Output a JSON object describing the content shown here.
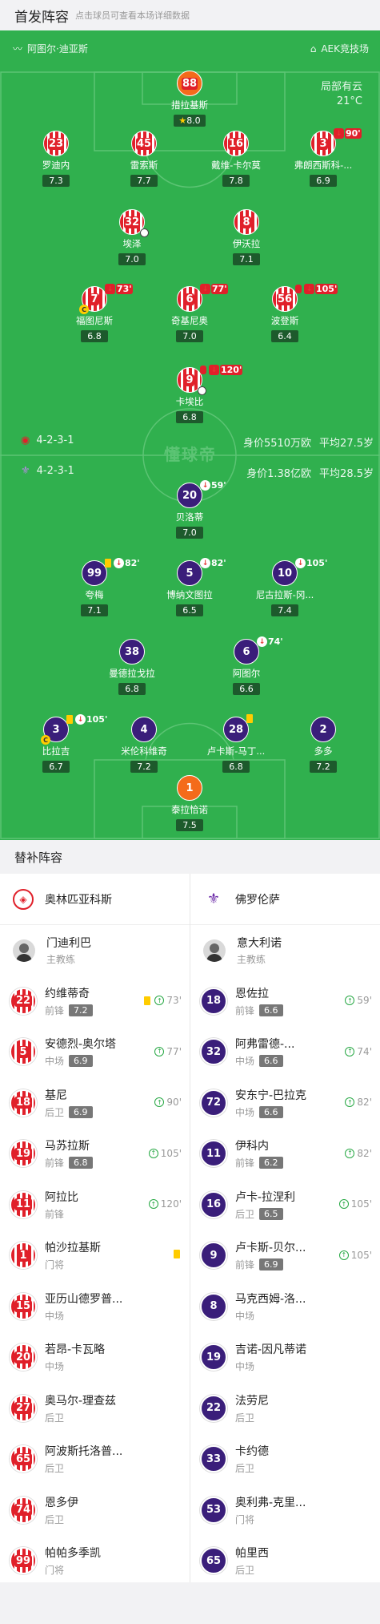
{
  "header": {
    "title": "首发阵容",
    "subtitle": "点击球员可查看本场详细数据"
  },
  "pitch": {
    "home_team": "阿图尔·迪亚斯",
    "stadium": "AEK竞技场",
    "weather": "局部有云",
    "temperature": "21°C",
    "home_formation": "4-2-3-1",
    "away_formation": "4-2-3-1",
    "home_value": "身价5510万欧",
    "home_age": "平均27.5岁",
    "away_value": "身价1.38亿欧",
    "away_age": "平均28.5岁",
    "watermark": "懂球帝"
  },
  "home_players": [
    {
      "num": "88",
      "name": "措拉基斯",
      "rating": "8.0",
      "star": true,
      "gk": true
    },
    {
      "num": "23",
      "name": "罗迪内",
      "rating": "7.3"
    },
    {
      "num": "45",
      "name": "雷索斯",
      "rating": "7.7"
    },
    {
      "num": "16",
      "name": "戴维-卡尔莫",
      "rating": "7.8"
    },
    {
      "num": "3",
      "name": "弗朗西斯科-...",
      "rating": "6.9",
      "sub": "90'"
    },
    {
      "num": "32",
      "name": "埃泽",
      "rating": "7.0",
      "ball": true
    },
    {
      "num": "8",
      "name": "伊沃拉",
      "rating": "7.1"
    },
    {
      "num": "7",
      "name": "福图尼斯",
      "rating": "6.8",
      "sub": "73'",
      "cap": true
    },
    {
      "num": "6",
      "name": "奇基尼奥",
      "rating": "7.0",
      "sub": "77'"
    },
    {
      "num": "56",
      "name": "波登斯",
      "rating": "6.4",
      "sub": "105'",
      "yellow": true
    },
    {
      "num": "9",
      "name": "卡埃比",
      "rating": "6.8",
      "sub": "120'",
      "yellow": true,
      "ball": true
    }
  ],
  "away_players": [
    {
      "num": "20",
      "name": "贝洛蒂",
      "rating": "7.0",
      "sub": "59'"
    },
    {
      "num": "99",
      "name": "夸梅",
      "rating": "7.1",
      "sub": "82'",
      "yellow": true
    },
    {
      "num": "5",
      "name": "博纳文图拉",
      "rating": "6.5",
      "sub": "82'"
    },
    {
      "num": "10",
      "name": "尼古拉斯-冈...",
      "rating": "7.4",
      "sub": "105'"
    },
    {
      "num": "38",
      "name": "曼德拉戈拉",
      "rating": "6.8"
    },
    {
      "num": "6",
      "name": "阿图尔",
      "rating": "6.6",
      "sub": "74'"
    },
    {
      "num": "3",
      "name": "比拉吉",
      "rating": "6.7",
      "sub": "105'",
      "yellow": true,
      "cap": true
    },
    {
      "num": "4",
      "name": "米伦科维奇",
      "rating": "7.2"
    },
    {
      "num": "28",
      "name": "卢卡斯-马丁...",
      "rating": "6.8",
      "yellow": true
    },
    {
      "num": "2",
      "name": "多多",
      "rating": "7.2"
    },
    {
      "num": "1",
      "name": "泰拉恰诺",
      "rating": "7.5",
      "gk": true
    }
  ],
  "subs": {
    "title": "替补阵容",
    "home_team": "奥林匹亚科斯",
    "away_team": "佛罗伦萨",
    "home_coach": {
      "name": "门迪利巴",
      "role": "主教练"
    },
    "away_coach": {
      "name": "意大利诺",
      "role": "主教练"
    },
    "home": [
      {
        "num": "22",
        "name": "约维蒂奇",
        "pos": "前锋",
        "rating": "7.2",
        "yellow": true,
        "in": "73'"
      },
      {
        "num": "5",
        "name": "安德烈-奥尔塔",
        "pos": "中场",
        "rating": "6.9",
        "in": "77'"
      },
      {
        "num": "18",
        "name": "基尼",
        "pos": "后卫",
        "rating": "6.9",
        "in": "90'"
      },
      {
        "num": "19",
        "name": "马苏拉斯",
        "pos": "前锋",
        "rating": "6.8",
        "in": "105'"
      },
      {
        "num": "11",
        "name": "阿拉比",
        "pos": "前锋",
        "rating": "",
        "in": "120'"
      },
      {
        "num": "1",
        "name": "帕沙拉基斯",
        "pos": "门将",
        "rating": "",
        "yellow": true
      },
      {
        "num": "15",
        "name": "亚历山德罗普...",
        "pos": "中场",
        "rating": ""
      },
      {
        "num": "20",
        "name": "若昂-卡瓦略",
        "pos": "中场",
        "rating": ""
      },
      {
        "num": "27",
        "name": "奥马尔-理查兹",
        "pos": "后卫",
        "rating": ""
      },
      {
        "num": "65",
        "name": "阿波斯托洛普...",
        "pos": "后卫",
        "rating": ""
      },
      {
        "num": "74",
        "name": "恩多伊",
        "pos": "后卫",
        "rating": ""
      },
      {
        "num": "99",
        "name": "帕帕多季凯",
        "pos": "门将",
        "rating": ""
      }
    ],
    "away": [
      {
        "num": "18",
        "name": "恩佐拉",
        "pos": "前锋",
        "rating": "6.6",
        "in": "59'"
      },
      {
        "num": "32",
        "name": "阿弗雷德-...",
        "pos": "中场",
        "rating": "6.6",
        "in": "74'"
      },
      {
        "num": "72",
        "name": "安东宁-巴拉克",
        "pos": "中场",
        "rating": "6.6",
        "in": "82'"
      },
      {
        "num": "11",
        "name": "伊科内",
        "pos": "前锋",
        "rating": "6.2",
        "in": "82'"
      },
      {
        "num": "16",
        "name": "卢卡-拉涅利",
        "pos": "后卫",
        "rating": "6.5",
        "in": "105'"
      },
      {
        "num": "9",
        "name": "卢卡斯-贝尔...",
        "pos": "前锋",
        "rating": "6.9",
        "in": "105'"
      },
      {
        "num": "8",
        "name": "马克西姆-洛...",
        "pos": "中场",
        "rating": ""
      },
      {
        "num": "19",
        "name": "吉诺-因凡蒂诺",
        "pos": "中场",
        "rating": ""
      },
      {
        "num": "22",
        "name": "法劳尼",
        "pos": "后卫",
        "rating": ""
      },
      {
        "num": "33",
        "name": "卡约德",
        "pos": "后卫",
        "rating": ""
      },
      {
        "num": "53",
        "name": "奥利弗-克里...",
        "pos": "门将",
        "rating": ""
      },
      {
        "num": "65",
        "name": "帕里西",
        "pos": "后卫",
        "rating": ""
      }
    ]
  }
}
